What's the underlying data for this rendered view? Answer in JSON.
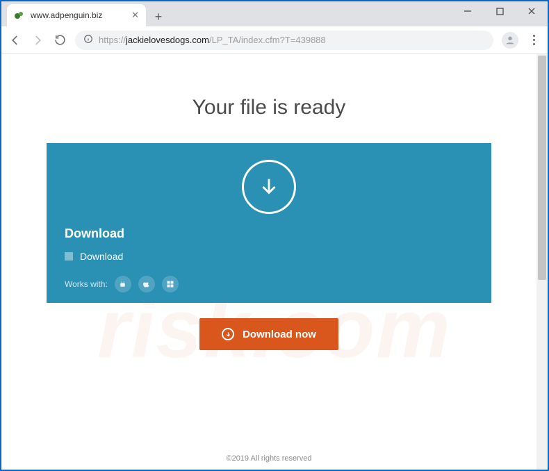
{
  "window": {
    "tab_title": "www.adpenguin.biz"
  },
  "address": {
    "scheme": "https://",
    "host": "jackielovesdogs.com",
    "path": "/LP_TA/index.cfm?T=439888"
  },
  "page": {
    "heading": "Your file is ready",
    "card": {
      "title": "Download",
      "checkbox_label": "Download",
      "works_with_label": "Works with:",
      "platforms": [
        "android",
        "apple",
        "windows"
      ]
    },
    "cta_label": "Download now",
    "footer": "©2019 All rights reserved"
  },
  "colors": {
    "card_bg": "#2b91b4",
    "cta_bg": "#d9571c",
    "window_accent": "#0a66c2"
  }
}
